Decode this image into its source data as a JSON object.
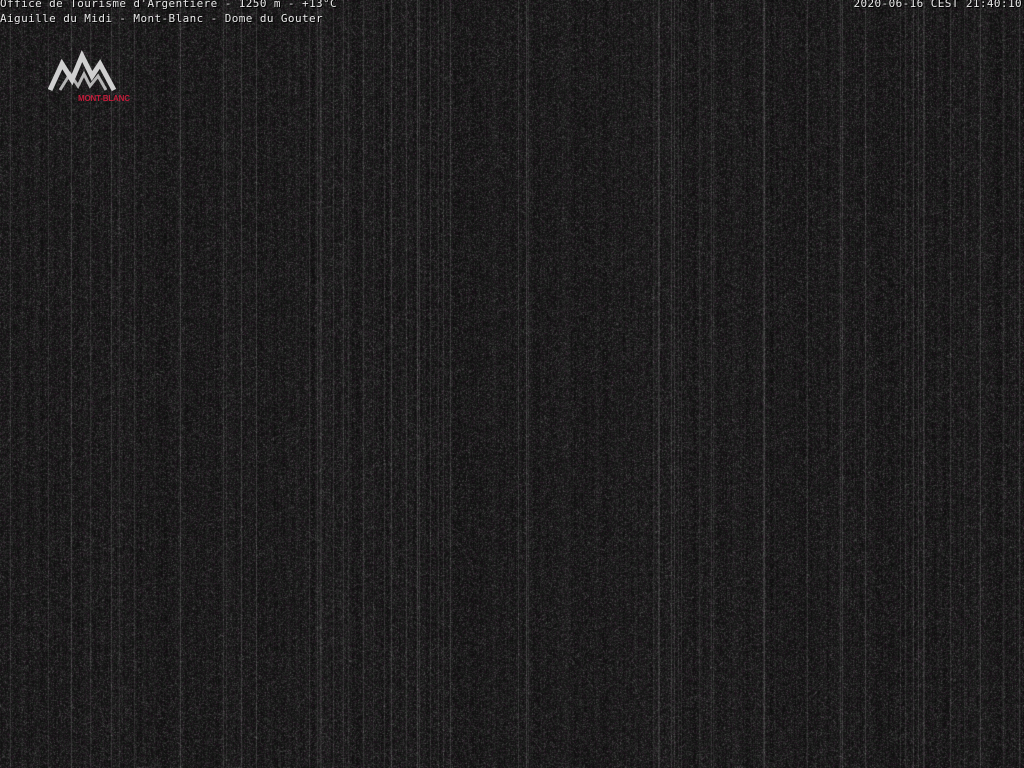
{
  "overlay": {
    "title_line": "Office de Tourisme d'Argentiere - 1250 m - +13°C",
    "subtitle_line": "Aiguille du Midi - Mont-Blanc - Dome du Gouter",
    "timestamp": "2020-06-16 CEST 21:40:10"
  },
  "logo": {
    "icon": "mountain-peaks-icon",
    "text": "MONT-BLANC",
    "color": "#c01c3a",
    "mark_color": "#cfcfcf"
  },
  "colors": {
    "background": "#141212",
    "overlay_text": "#e8e8e8"
  }
}
